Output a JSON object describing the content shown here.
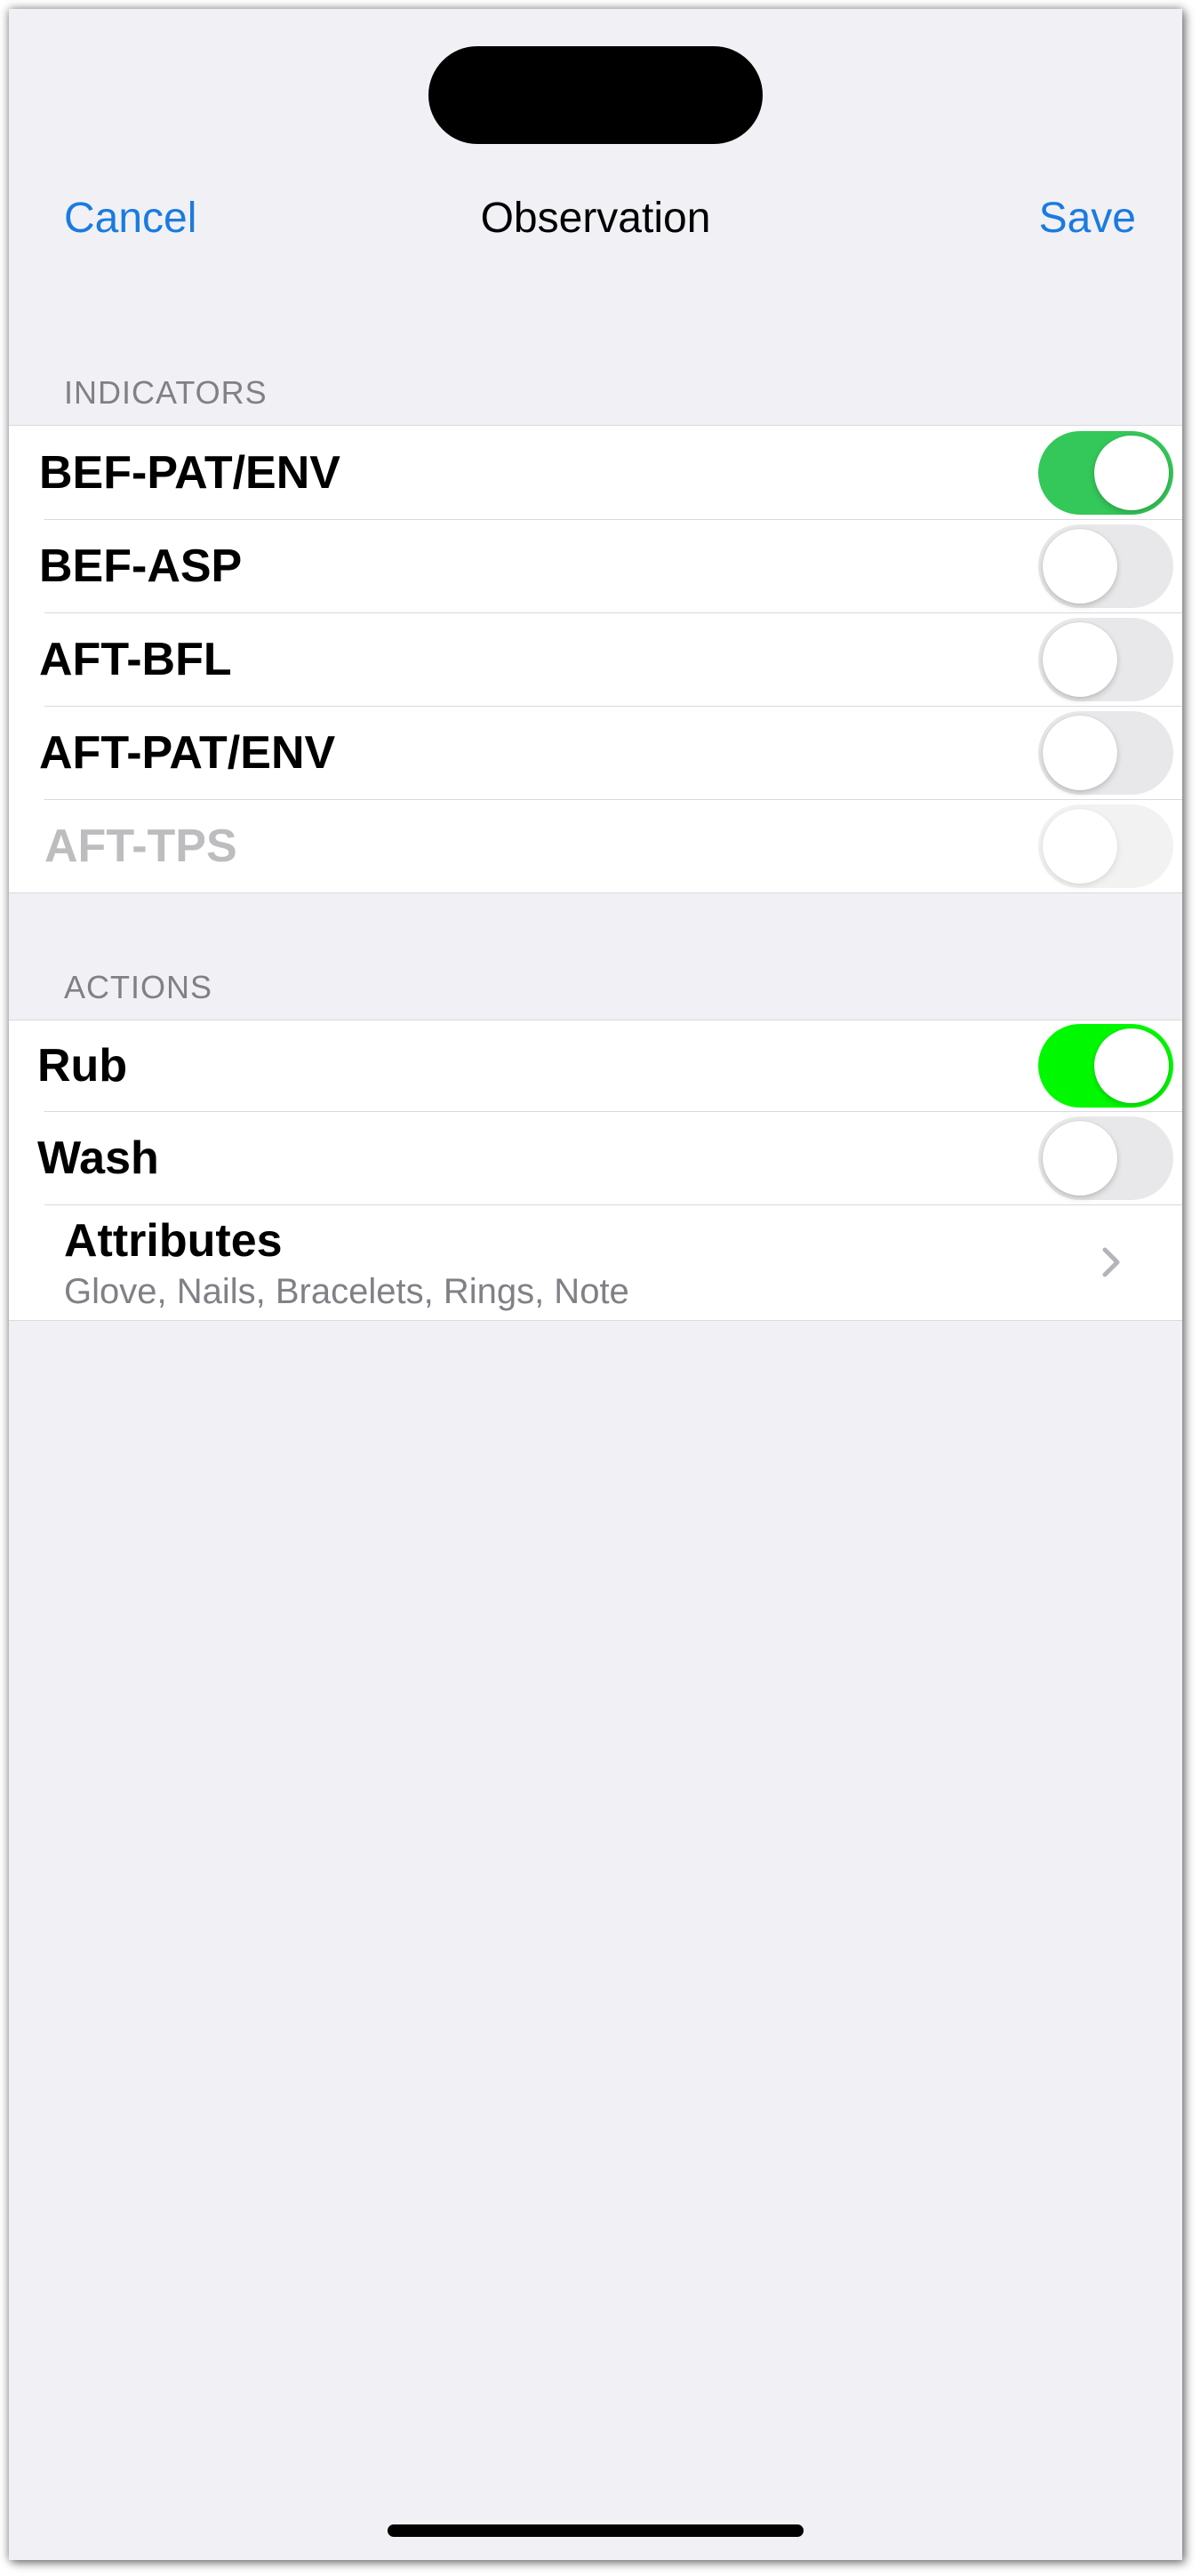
{
  "nav": {
    "cancel_label": "Cancel",
    "title": "Observation",
    "save_label": "Save",
    "accent_color": "#1a7be0"
  },
  "indicators": {
    "header": "INDICATORS",
    "items": [
      {
        "label": "BEF-PAT/ENV",
        "on": true,
        "enabled": true,
        "on_color": "#34c759"
      },
      {
        "label": "BEF-ASP",
        "on": false,
        "enabled": true
      },
      {
        "label": "AFT-BFL",
        "on": false,
        "enabled": true
      },
      {
        "label": "AFT-PAT/ENV",
        "on": false,
        "enabled": true
      },
      {
        "label": "AFT-TPS",
        "on": false,
        "enabled": false
      }
    ]
  },
  "actions": {
    "header": "ACTIONS",
    "items": [
      {
        "label": "Rub",
        "on": true,
        "enabled": true,
        "on_color": "#00f900"
      },
      {
        "label": "Wash",
        "on": false,
        "enabled": true
      }
    ],
    "attributes": {
      "title": "Attributes",
      "subtitle": "Glove, Nails, Bracelets, Rings, Note",
      "icon": "chevron-right-icon"
    }
  }
}
